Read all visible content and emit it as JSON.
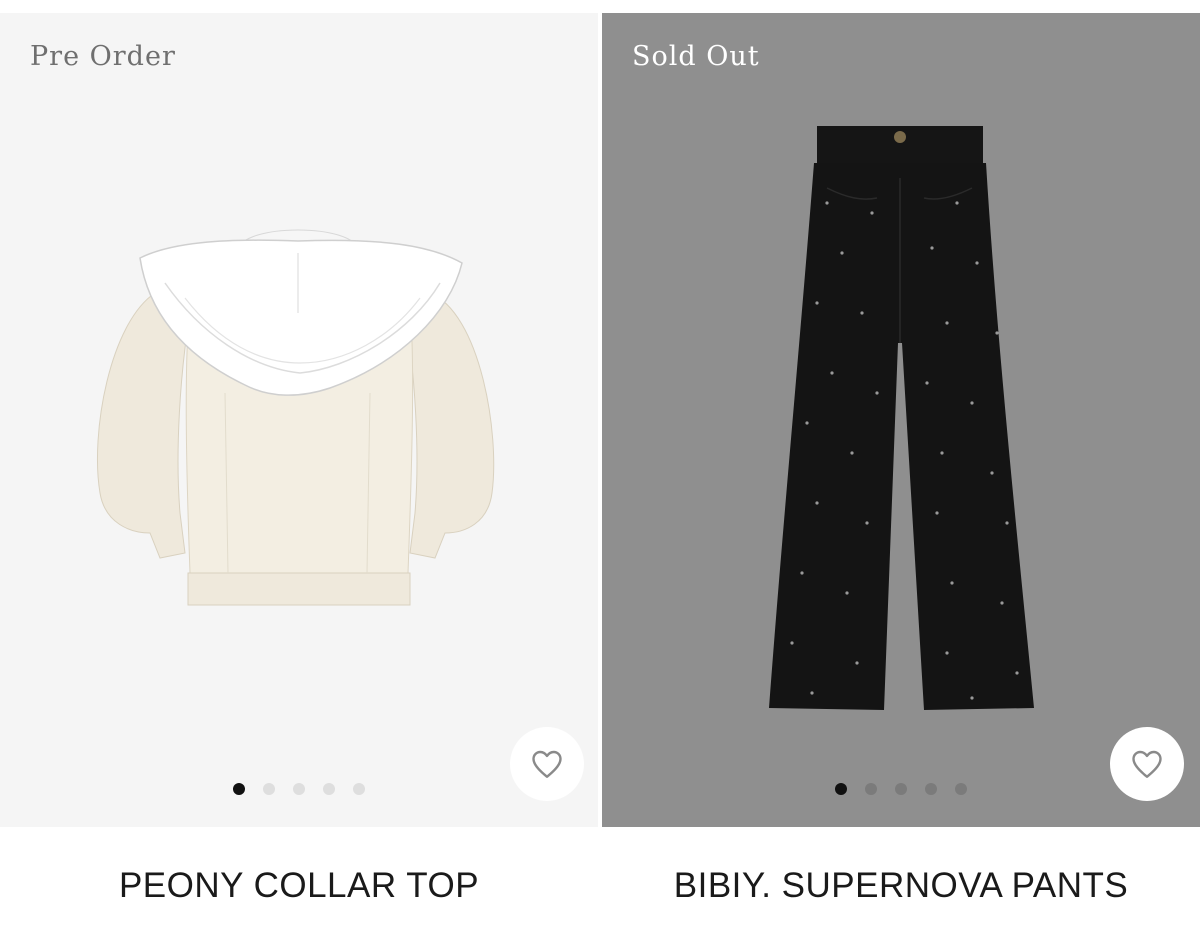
{
  "products": [
    {
      "badge": "Pre Order",
      "name": "PEONY COLLAR TOP",
      "image_bg": "#f5f5f5",
      "image_count": 5,
      "active_image": 1,
      "icon": "heart-icon"
    },
    {
      "badge": "Sold Out",
      "name": "BIBIY. SUPERNOVA PANTS",
      "image_bg": "#8f8f8f",
      "image_count": 5,
      "active_image": 1,
      "icon": "heart-icon"
    }
  ]
}
